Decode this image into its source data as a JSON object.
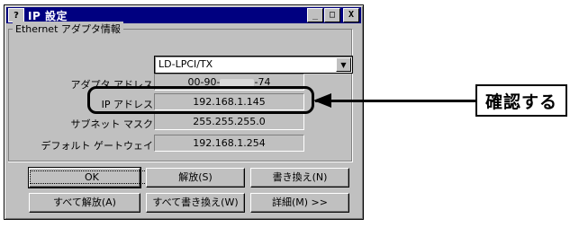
{
  "window": {
    "title": "IP 設定",
    "icon": "network-help-icon",
    "controls": {
      "minimize": "_",
      "maximize": "□",
      "close": "X"
    }
  },
  "group": {
    "label": "Ethernet  アダプタ情報"
  },
  "adapter": {
    "selected": "LD-LPCI/TX"
  },
  "rows": {
    "mac_label": "アダプタ アドレス",
    "mac_prefix": "00-90-",
    "mac_suffix": "-74",
    "ip_label": "IP アドレス",
    "ip_value": "192.168.1.145",
    "mask_label": "サブネット マスク",
    "mask_value": "255.255.255.0",
    "gw_label": "デフォルト ゲートウェイ",
    "gw_value": "192.168.1.254"
  },
  "buttons": {
    "ok": "OK",
    "release": "解放(S)",
    "renew": "書き換え(N)",
    "release_all": "すべて解放(A)",
    "renew_all": "すべて書き換え(W)",
    "details": "詳細(M) >>"
  },
  "callout": {
    "text": "確認する"
  }
}
